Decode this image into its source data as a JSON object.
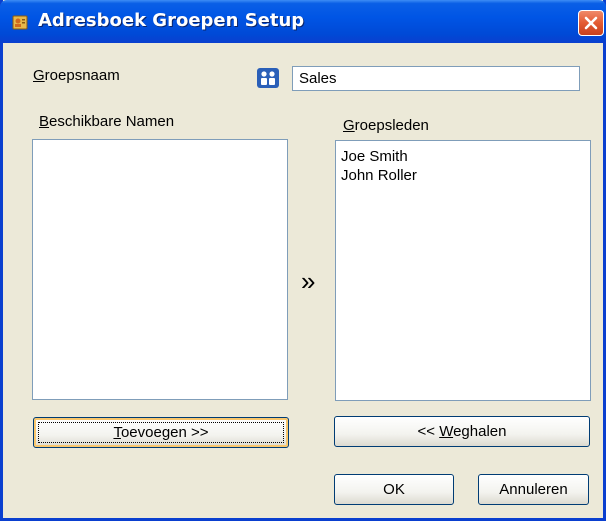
{
  "window": {
    "title": "Adresboek Groepen Setup",
    "close_icon": "close-icon"
  },
  "group_name": {
    "label": "Groepsnaam",
    "value": "Sales",
    "icon": "group-people-icon"
  },
  "available": {
    "label": "Beschikbare Namen",
    "items": []
  },
  "members": {
    "label": "Groepsleden",
    "items": [
      "Joe Smith",
      "John Roller"
    ]
  },
  "transfer_icon": "double-chevron-right-icon",
  "buttons": {
    "add": {
      "underline": "T",
      "rest": "oevoegen >>"
    },
    "remove": {
      "prefix": "<< ",
      "underline": "W",
      "rest": "eghalen"
    },
    "ok": "OK",
    "cancel": "Annuleren"
  }
}
